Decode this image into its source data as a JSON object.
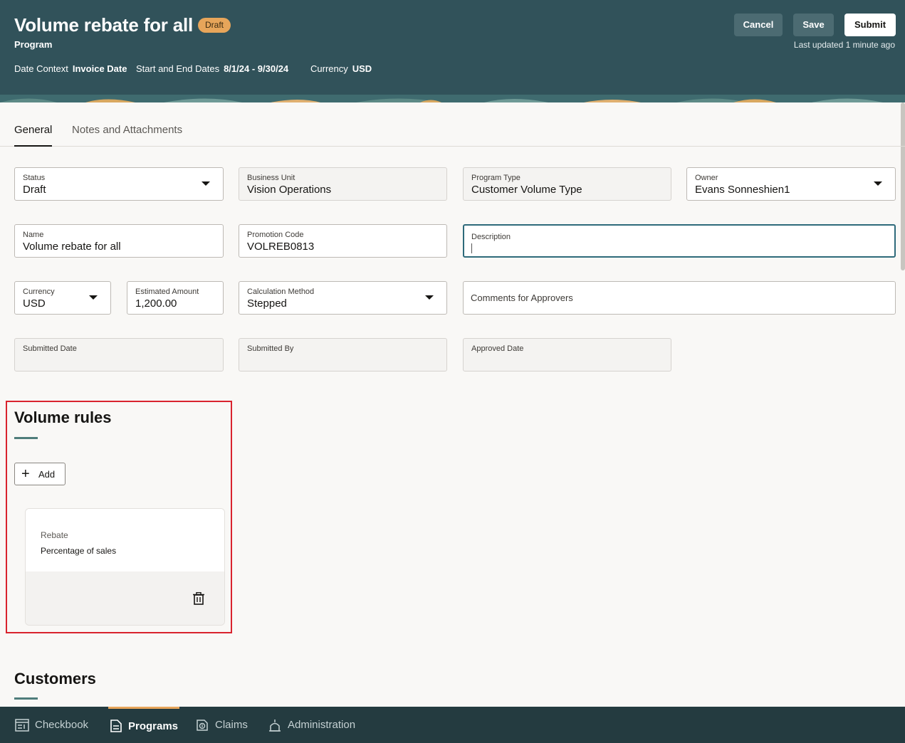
{
  "header": {
    "title": "Volume rebate for all",
    "status_badge": "Draft",
    "subtitle": "Program",
    "date_context_label": "Date Context",
    "date_context_value": "Invoice Date",
    "dates_label": "Start and End Dates",
    "dates_value": "8/1/24 - 9/30/24",
    "currency_label": "Currency",
    "currency_value": "USD",
    "cancel_label": "Cancel",
    "save_label": "Save",
    "submit_label": "Submit",
    "last_updated": "Last updated 1 minute ago",
    "colors": {
      "background": "#31525a",
      "badge": "#e7a55a"
    }
  },
  "tabs": [
    {
      "label": "General",
      "active": true
    },
    {
      "label": "Notes and Attachments",
      "active": false
    }
  ],
  "form": {
    "status": {
      "label": "Status",
      "value": "Draft"
    },
    "business_unit": {
      "label": "Business Unit",
      "value": "Vision Operations"
    },
    "program_type": {
      "label": "Program Type",
      "value": "Customer Volume Type"
    },
    "owner": {
      "label": "Owner",
      "value": "Evans Sonneshien1"
    },
    "name": {
      "label": "Name",
      "value": "Volume rebate for all"
    },
    "promotion_code": {
      "label": "Promotion Code",
      "value": "VOLREB0813"
    },
    "description": {
      "label": "Description",
      "value": ""
    },
    "currency": {
      "label": "Currency",
      "value": "USD"
    },
    "estimated_amount": {
      "label": "Estimated Amount",
      "value": "1,200.00"
    },
    "calculation_method": {
      "label": "Calculation Method",
      "value": "Stepped"
    },
    "comments": {
      "label": "Comments for Approvers"
    },
    "submitted_date": {
      "label": "Submitted Date",
      "value": ""
    },
    "submitted_by": {
      "label": "Submitted By",
      "value": ""
    },
    "approved_date": {
      "label": "Approved Date",
      "value": ""
    }
  },
  "volume_rules": {
    "title": "Volume rules",
    "add_label": "Add",
    "card": {
      "label": "Rebate",
      "value": "Percentage of sales",
      "delete_icon": "trash-icon"
    }
  },
  "customers": {
    "title": "Customers"
  },
  "bottom_nav": [
    {
      "label": "Checkbook",
      "icon": "checkbook-icon",
      "active": false
    },
    {
      "label": "Programs",
      "icon": "programs-icon",
      "active": true
    },
    {
      "label": "Claims",
      "icon": "claims-icon",
      "active": false
    },
    {
      "label": "Administration",
      "icon": "administration-icon",
      "active": false
    }
  ]
}
